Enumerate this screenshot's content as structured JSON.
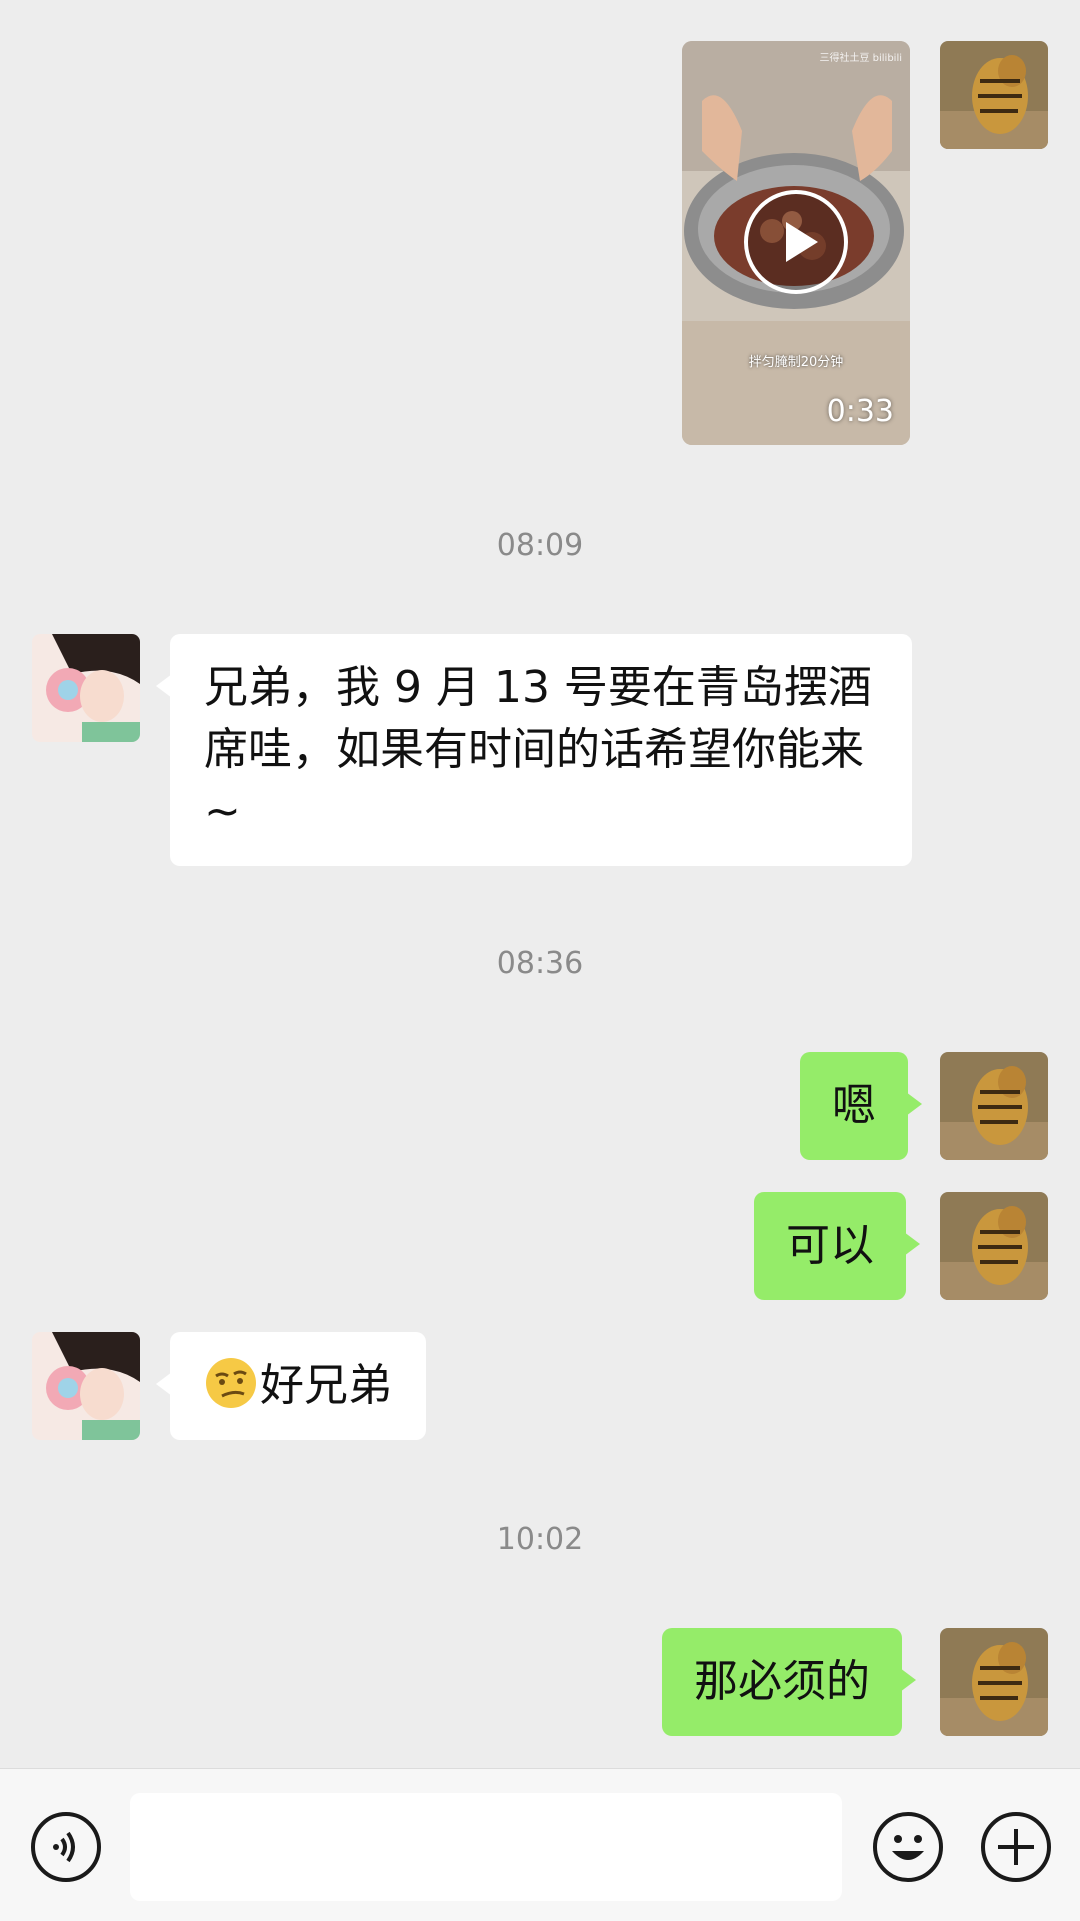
{
  "conversation": {
    "video_message": {
      "duration": "0:33",
      "subtitle": "拌匀腌制20分钟",
      "watermark": "三得社土豆 bilibili"
    },
    "timestamps": [
      "08:09",
      "08:36",
      "10:02"
    ],
    "messages": {
      "friend_1": "兄弟，我 9 月 13 号要在青岛摆酒席哇，如果有时间的话希望你能来~",
      "me_1": "嗯",
      "me_2": "可以",
      "friend_2": "好兄弟",
      "me_3": "那必须的"
    }
  },
  "input_bar": {
    "voice_icon": "voice-icon",
    "emoji_icon": "emoji-icon",
    "plus_icon": "plus-icon",
    "input_value": ""
  },
  "colors": {
    "background": "#ededed",
    "my_bubble": "#95ec69",
    "friend_bubble": "#ffffff"
  }
}
